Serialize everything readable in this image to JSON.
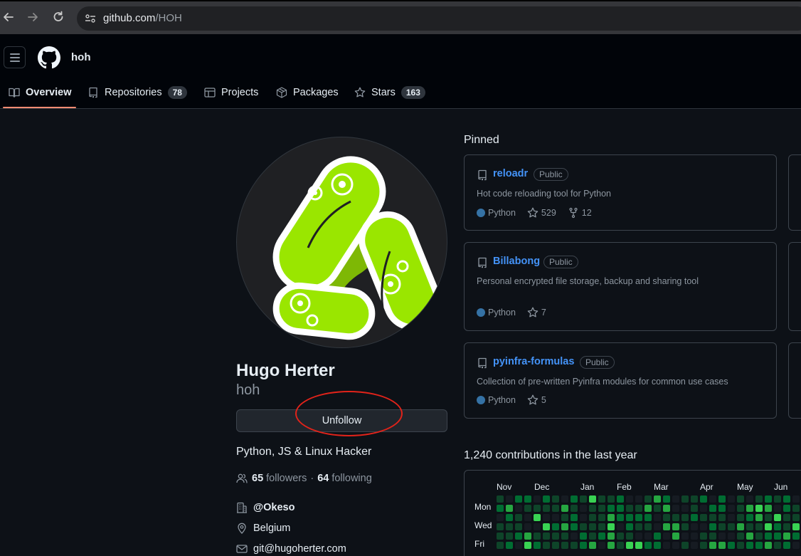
{
  "browser": {
    "url_host": "github.com",
    "url_path": "/HOH"
  },
  "header": {
    "username": "hoh"
  },
  "tabs": [
    {
      "label": "Overview",
      "icon": "book-icon"
    },
    {
      "label": "Repositories",
      "icon": "repo-icon",
      "count": "78"
    },
    {
      "label": "Projects",
      "icon": "table-icon"
    },
    {
      "label": "Packages",
      "icon": "package-icon"
    },
    {
      "label": "Stars",
      "icon": "star-icon",
      "count": "163"
    }
  ],
  "profile": {
    "fullname": "Hugo Herter",
    "login": "hoh",
    "follow_button": "Unfollow",
    "bio": "Python, JS & Linux Hacker",
    "followers_count": "65",
    "followers_label": "followers",
    "separator": "·",
    "following_count": "64",
    "following_label": "following",
    "organization": "@Okeso",
    "location": "Belgium",
    "email": "git@hugoherter.com"
  },
  "pinned": {
    "title": "Pinned",
    "repos": [
      {
        "name": "reloadr",
        "visibility": "Public",
        "description": "Hot code reloading tool for Python",
        "language": "Python",
        "stars": "529",
        "forks": "12"
      },
      {
        "name": "Billabong",
        "visibility": "Public",
        "description": "Personal encrypted file storage, backup and sharing tool",
        "language": "Python",
        "stars": "7"
      },
      {
        "name": "pyinfra-formulas",
        "visibility": "Public",
        "description": "Collection of pre-written Pyinfra modules for common use cases",
        "language": "Python",
        "stars": "5"
      }
    ]
  },
  "contributions": {
    "title": "1,240 contributions in the last year",
    "months": [
      "Nov",
      "Dec",
      "Jan",
      "Feb",
      "Mar",
      "Apr",
      "May",
      "Jun"
    ],
    "days": [
      "Mon",
      "Wed",
      "Fri"
    ]
  },
  "colors": {
    "accent_link": "#4493f8",
    "tab_underline": "#fd8c73",
    "python": "#3572A5",
    "annotation": "#e2231a",
    "levels": [
      "#161b22",
      "#0e4429",
      "#006d32",
      "#26a641",
      "#39d353"
    ]
  }
}
